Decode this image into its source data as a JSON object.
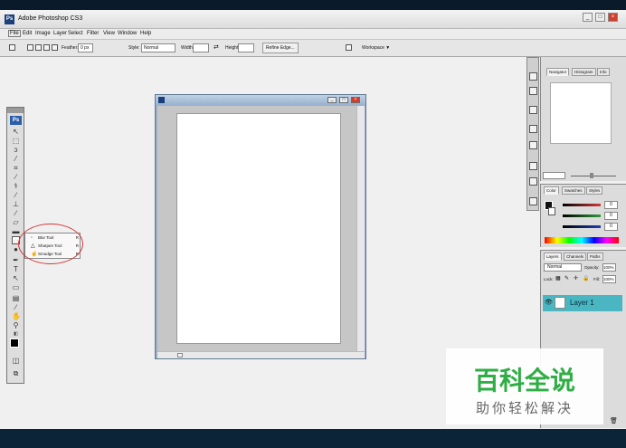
{
  "app": {
    "title": "Adobe Photoshop CS3",
    "icon_text": "Ps"
  },
  "window_controls": {
    "minimize": "_",
    "maximize": "□",
    "close": "×"
  },
  "menu": [
    "File",
    "Edit",
    "Image",
    "Layer",
    "Select",
    "Filter",
    "View",
    "Window",
    "Help"
  ],
  "options_bar": {
    "feather_label": "Feather:",
    "feather_value": "0 px",
    "style_label": "Style:",
    "style_value": "Normal",
    "width_label": "Width:",
    "height_label": "Height:",
    "refine_edge": "Refine Edge...",
    "workspace": "Workspace ▼"
  },
  "toolbox": {
    "logo": "Ps"
  },
  "tool_flyout": [
    {
      "name": "Blur Tool",
      "key": "R",
      "icon": "drop-icon"
    },
    {
      "name": "Sharpen Tool",
      "key": "R",
      "icon": "triangle-icon"
    },
    {
      "name": "Smudge Tool",
      "key": "R",
      "icon": "finger-icon"
    }
  ],
  "nav_panel": {
    "tabs": [
      "Navigator",
      "Histogram",
      "Info"
    ]
  },
  "color_panel": {
    "tabs": [
      "Color",
      "Swatches",
      "Styles"
    ],
    "values": [
      "0",
      "0",
      "0"
    ],
    "colors": {
      "r": "#d23b3b",
      "g": "#2e9c3a",
      "b": "#1d3fb8"
    }
  },
  "layers_panel": {
    "tabs": [
      "Layers",
      "Channels",
      "Paths"
    ],
    "blend_mode": "Normal",
    "opacity_label": "Opacity:",
    "opacity_value": "100%",
    "lock_label": "Lock:",
    "fill_label": "Fill:",
    "fill_value": "100%",
    "layer_name": "Layer 1"
  },
  "watermark": {
    "title": "百科全说",
    "subtitle": "助你轻松解决"
  },
  "colors": {
    "accent_layer": "#49b6c2",
    "highlight": "#d23a3a",
    "titlebar_doc": "#97b0cc"
  }
}
